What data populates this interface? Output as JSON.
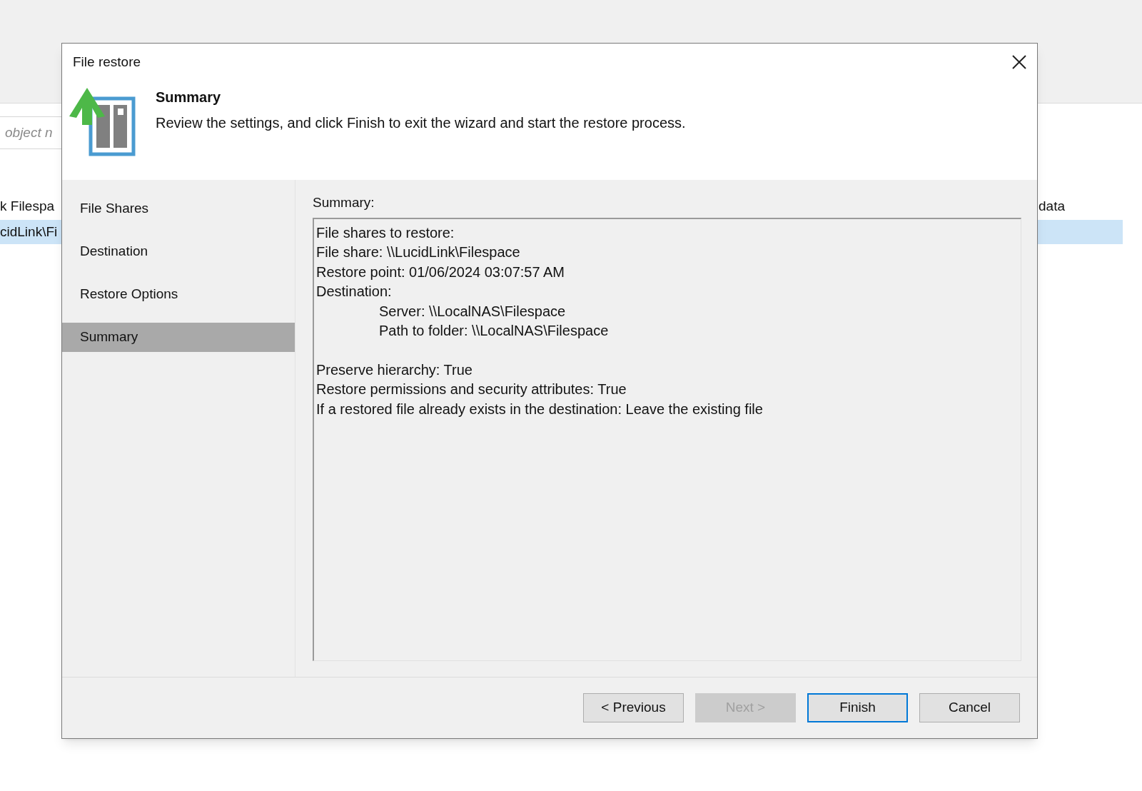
{
  "background": {
    "search_placeholder": "object n",
    "rows": [
      {
        "text": "k Filespa",
        "selected": false
      },
      {
        "text": "cidLink\\Fi",
        "selected": true
      }
    ],
    "right_column_text": "data"
  },
  "window": {
    "title": "File restore"
  },
  "header": {
    "title": "Summary",
    "description": "Review the settings, and click Finish to exit the wizard and start the restore process."
  },
  "steps": [
    {
      "label": "File Shares",
      "selected": false
    },
    {
      "label": "Destination",
      "selected": false
    },
    {
      "label": "Restore Options",
      "selected": false
    },
    {
      "label": "Summary",
      "selected": true
    }
  ],
  "summary": {
    "label": "Summary:",
    "lines": [
      {
        "text": "File shares to restore:",
        "indented": false,
        "gap_before": false
      },
      {
        "text": "File share: \\\\LucidLink\\Filespace",
        "indented": false,
        "gap_before": false
      },
      {
        "text": "Restore point: 01/06/2024 03:07:57 AM",
        "indented": false,
        "gap_before": false
      },
      {
        "text": "Destination:",
        "indented": false,
        "gap_before": false
      },
      {
        "text": "Server: \\\\LocalNAS\\Filespace",
        "indented": true,
        "gap_before": false
      },
      {
        "text": "Path to folder: \\\\LocalNAS\\Filespace",
        "indented": true,
        "gap_before": false
      },
      {
        "text": "Preserve hierarchy: True",
        "indented": false,
        "gap_before": true
      },
      {
        "text": "Restore permissions and security attributes: True",
        "indented": false,
        "gap_before": false
      },
      {
        "text": "If a restored file already exists in the destination: Leave the existing file",
        "indented": false,
        "gap_before": false
      }
    ]
  },
  "buttons": [
    {
      "label": "< Previous",
      "disabled": false,
      "default": false
    },
    {
      "label": "Next >",
      "disabled": true,
      "default": false
    },
    {
      "label": "Finish",
      "disabled": false,
      "default": true
    },
    {
      "label": "Cancel",
      "disabled": false,
      "default": false
    }
  ]
}
